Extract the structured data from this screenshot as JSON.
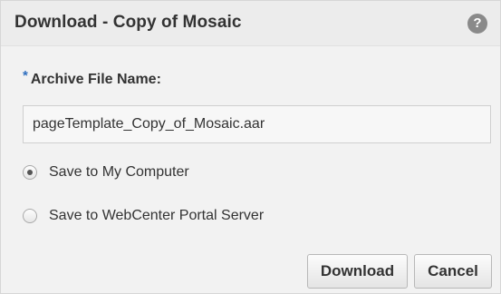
{
  "dialog": {
    "title": "Download - Copy of Mosaic",
    "help_icon": "question-icon",
    "help_symbol": "?"
  },
  "form": {
    "required_marker": "*",
    "archive_label": "Archive File Name:",
    "archive_value": "pageTemplate_Copy_of_Mosaic.aar",
    "options": [
      {
        "label": "Save to My Computer",
        "selected": true
      },
      {
        "label": "Save to WebCenter Portal Server",
        "selected": false
      }
    ]
  },
  "buttons": {
    "download": "Download",
    "cancel": "Cancel"
  },
  "colors": {
    "required_marker": "#2f6fbf",
    "dialog_background": "#f2f2f2",
    "title_text": "#333333"
  }
}
